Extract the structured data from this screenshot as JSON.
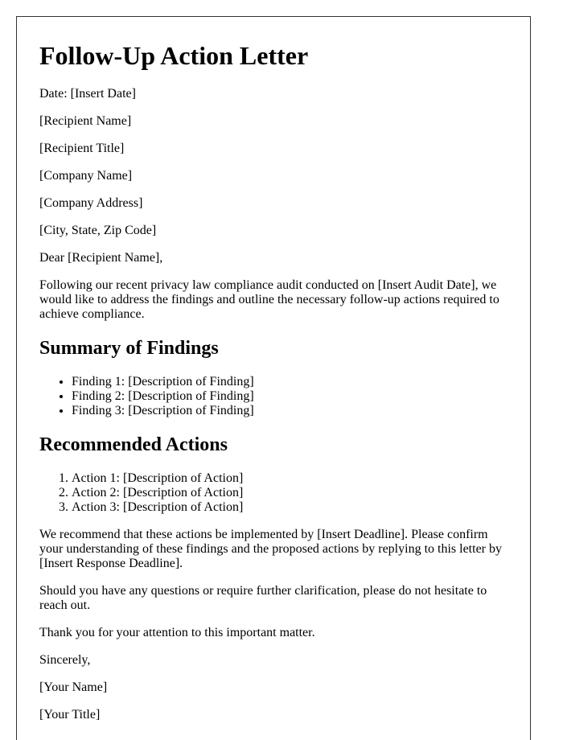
{
  "title": "Follow-Up Action Letter",
  "header_lines": [
    "Date: [Insert Date]",
    "[Recipient Name]",
    "[Recipient Title]",
    "[Company Name]",
    "[Company Address]",
    "[City, State, Zip Code]"
  ],
  "salutation": "Dear [Recipient Name],",
  "intro": "Following our recent privacy law compliance audit conducted on [Insert Audit Date], we would like to address the findings and outline the necessary follow-up actions required to achieve compliance.",
  "findings": {
    "heading": "Summary of Findings",
    "items": [
      "Finding 1: [Description of Finding]",
      "Finding 2: [Description of Finding]",
      "Finding 3: [Description of Finding]"
    ]
  },
  "actions": {
    "heading": "Recommended Actions",
    "items": [
      "Action 1: [Description of Action]",
      "Action 2: [Description of Action]",
      "Action 3: [Description of Action]"
    ]
  },
  "closing_paragraphs": [
    "We recommend that these actions be implemented by [Insert Deadline]. Please confirm your understanding of these findings and the proposed actions by replying to this letter by [Insert Response Deadline].",
    "Should you have any questions or require further clarification, please do not hesitate to reach out.",
    "Thank you for your attention to this important matter."
  ],
  "signoff": "Sincerely,",
  "signature": {
    "name": "[Your Name]",
    "title": "[Your Title]"
  }
}
